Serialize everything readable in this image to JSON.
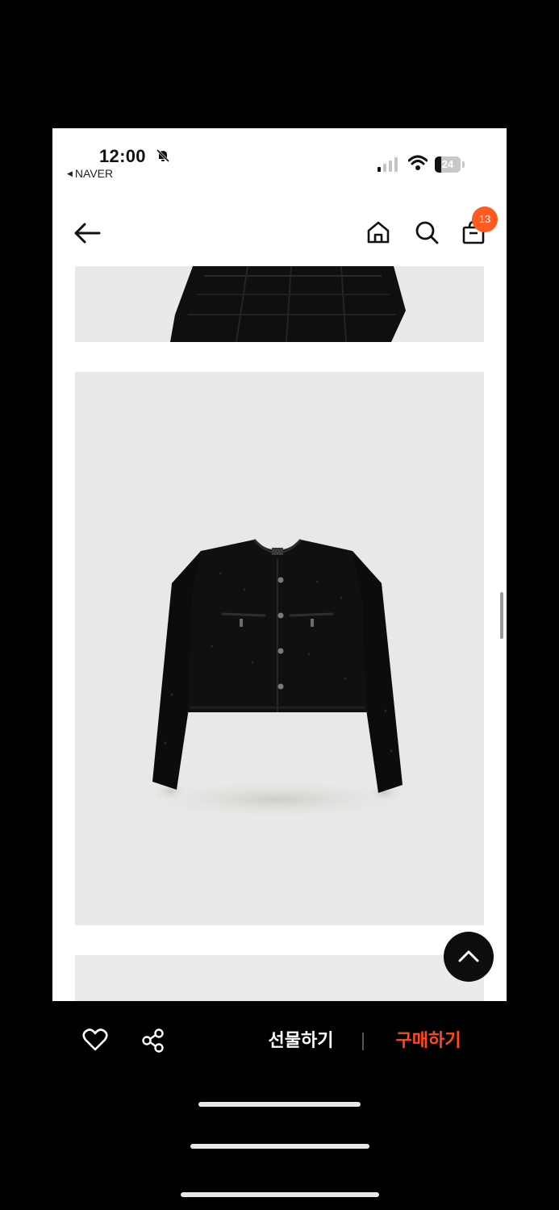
{
  "status_bar": {
    "time": "12:00",
    "back_app_label": "NAVER",
    "battery_level": "24",
    "battery_fraction": 0.24
  },
  "nav": {
    "cart_badge_count": "13",
    "icons": [
      "back-arrow-icon",
      "home-icon",
      "search-icon",
      "shopping-bag-icon"
    ]
  },
  "content": {
    "images": [
      "tweed-skirt-image",
      "tweed-cropped-jacket-image",
      "next-product-image"
    ],
    "scroll_top_icon": "chevron-up-icon"
  },
  "bottom_bar": {
    "like_icon": "heart-icon",
    "share_icon": "share-icon",
    "gift_label": "선물하기",
    "buy_label": "구매하기"
  },
  "colors": {
    "accent": "#ff4a1c",
    "badge": "#ff5a1f",
    "background": "#000000",
    "screen": "#ffffff",
    "product_bg": "#e8e8e6"
  }
}
